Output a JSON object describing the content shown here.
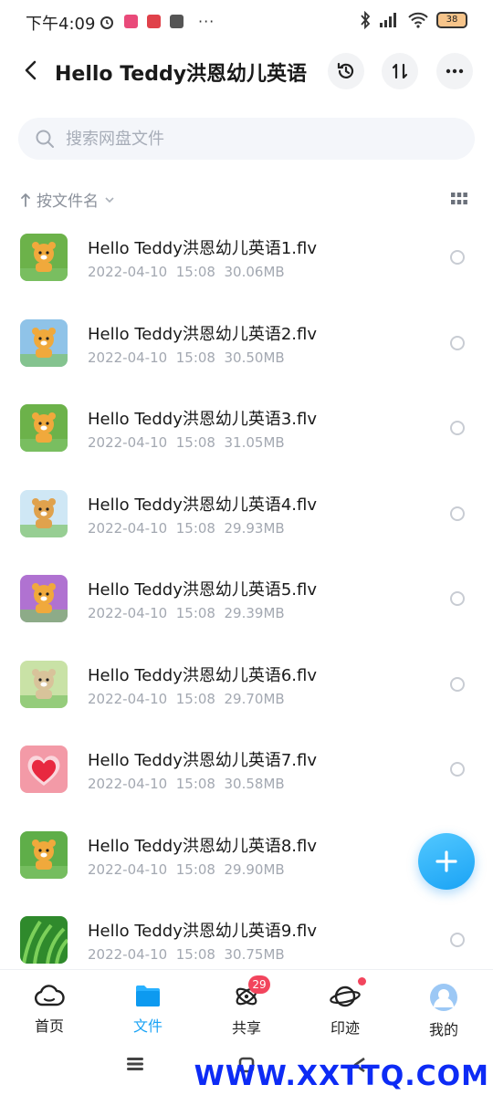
{
  "status_bar": {
    "time": "下午4:09",
    "more": "···",
    "battery": "38"
  },
  "header": {
    "title": "Hello Teddy洪恩幼儿英语"
  },
  "search": {
    "placeholder": "搜索网盘文件"
  },
  "sort": {
    "label": "按文件名"
  },
  "files": [
    {
      "name": "Hello Teddy洪恩幼儿英语1.flv",
      "date": "2022-04-10",
      "time": "15:08",
      "size": "30.06MB",
      "thumb": "teddy-icon",
      "c1": "#6cb24a",
      "c2": "#f0a93c"
    },
    {
      "name": "Hello Teddy洪恩幼儿英语2.flv",
      "date": "2022-04-10",
      "time": "15:08",
      "size": "30.50MB",
      "thumb": "teddy-icon",
      "c1": "#8fc3e8",
      "c2": "#f0a93c"
    },
    {
      "name": "Hello Teddy洪恩幼儿英语3.flv",
      "date": "2022-04-10",
      "time": "15:08",
      "size": "31.05MB",
      "thumb": "teddy-icon",
      "c1": "#6cb24a",
      "c2": "#f0a93c"
    },
    {
      "name": "Hello Teddy洪恩幼儿英语4.flv",
      "date": "2022-04-10",
      "time": "15:08",
      "size": "29.93MB",
      "thumb": "teddy-icon",
      "c1": "#cfe7f5",
      "c2": "#e0a24d"
    },
    {
      "name": "Hello Teddy洪恩幼儿英语5.flv",
      "date": "2022-04-10",
      "time": "15:08",
      "size": "29.39MB",
      "thumb": "teddy-icon",
      "c1": "#b072d1",
      "c2": "#f0a93c"
    },
    {
      "name": "Hello Teddy洪恩幼儿英语6.flv",
      "date": "2022-04-10",
      "time": "15:08",
      "size": "29.70MB",
      "thumb": "teddy-icon",
      "c1": "#c9e2a6",
      "c2": "#d8c39a"
    },
    {
      "name": "Hello Teddy洪恩幼儿英语7.flv",
      "date": "2022-04-10",
      "time": "15:08",
      "size": "30.58MB",
      "thumb": "heart-icon",
      "c1": "#f39aa7",
      "c2": "#e8283f"
    },
    {
      "name": "Hello Teddy洪恩幼儿英语8.flv",
      "date": "2022-04-10",
      "time": "15:08",
      "size": "29.90MB",
      "thumb": "teddy-icon",
      "c1": "#5fae49",
      "c2": "#f0a93c"
    },
    {
      "name": "Hello Teddy洪恩幼儿英语9.flv",
      "date": "2022-04-10",
      "time": "15:08",
      "size": "30.75MB",
      "thumb": "grass-icon",
      "c1": "#2f8a2c",
      "c2": "#7cd05a"
    }
  ],
  "bottom_nav": {
    "home": "首页",
    "files": "文件",
    "share": "共享",
    "share_badge": "29",
    "trace": "印迹",
    "mine": "我的"
  },
  "watermark": "WWW.XXTTQ.COM",
  "colors": {
    "accent": "#1aa3f5",
    "badge": "#f2455d"
  }
}
